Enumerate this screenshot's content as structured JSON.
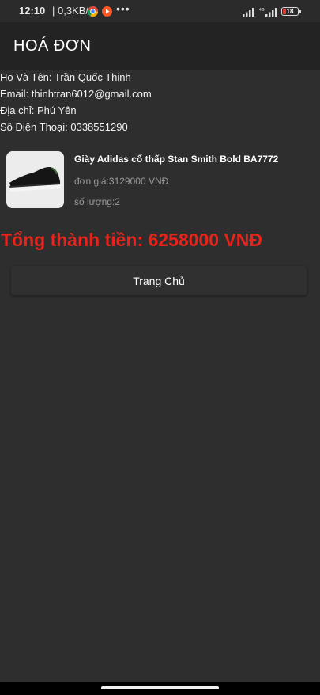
{
  "status_bar": {
    "time": "12:10",
    "network_speed": "| 0,3KB/s",
    "dots": "•••",
    "battery_level": "18"
  },
  "app_bar": {
    "title": "HOÁ ĐƠN"
  },
  "customer": {
    "name_line": "Họ Và Tên: Trần Quốc Thịnh",
    "email_line": "Email: thinhtran6012@gmail.com",
    "address_line": "Địa chỉ: Phú Yên",
    "phone_line": "Số Điện Thoại: 0338551290"
  },
  "products": [
    {
      "name": "Giày Adidas cổ thấp Stan Smith Bold BA7772",
      "unit_price_line": "đơn giá:3129000 VNĐ",
      "quantity_line": "số lượng:2",
      "image": "black-sneaker"
    }
  ],
  "total_line": "Tổng thành tiền: 6258000 VNĐ",
  "buttons": {
    "home_label": "Trang Chủ"
  },
  "colors": {
    "background": "#2e2e2e",
    "app_bar": "#232323",
    "total_text": "#e8231c",
    "secondary_text": "#9a9a9a"
  }
}
